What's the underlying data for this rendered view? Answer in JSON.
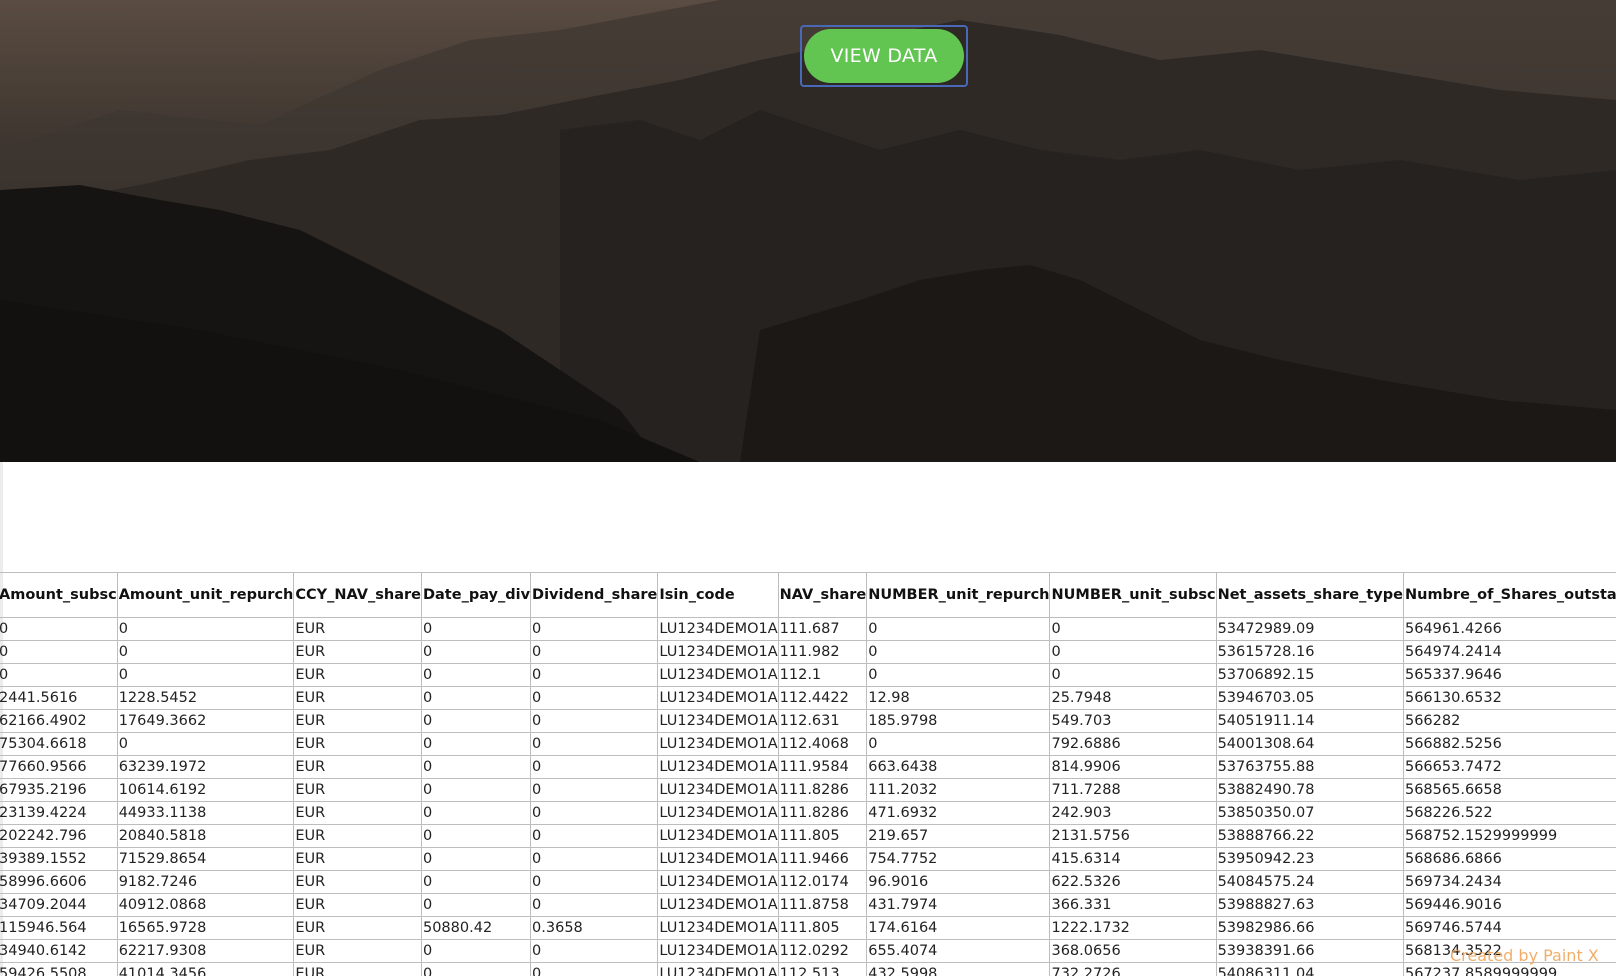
{
  "hero": {
    "button_label": "VIEW DATA"
  },
  "table": {
    "headers": [
      "Amount_subsc",
      "Amount_unit_repurch",
      "CCY_NAV_share",
      "Date_pay_div",
      "Dividend_share",
      "Isin_code",
      "NAV_share",
      "NUMBER_unit_repurch",
      "NUMBER_unit_subsc",
      "Net_assets_share_type",
      "Numbre_of_Shares_outstanding"
    ],
    "rows": [
      [
        "0",
        "0",
        "EUR",
        "0",
        "0",
        "LU1234DEMO1A",
        "111.687",
        "0",
        "0",
        "53472989.09",
        "564961.4266"
      ],
      [
        "0",
        "0",
        "EUR",
        "0",
        "0",
        "LU1234DEMO1A",
        "111.982",
        "0",
        "0",
        "53615728.16",
        "564974.2414"
      ],
      [
        "0",
        "0",
        "EUR",
        "0",
        "0",
        "LU1234DEMO1A",
        "112.1",
        "0",
        "0",
        "53706892.15",
        "565337.9646"
      ],
      [
        "2441.5616",
        "1228.5452",
        "EUR",
        "0",
        "0",
        "LU1234DEMO1A",
        "112.4422",
        "12.98",
        "25.7948",
        "53946703.05",
        "566130.6532"
      ],
      [
        "62166.4902",
        "17649.3662",
        "EUR",
        "0",
        "0",
        "LU1234DEMO1A",
        "112.631",
        "185.9798",
        "549.703",
        "54051911.14",
        "566282"
      ],
      [
        "75304.6618",
        "0",
        "EUR",
        "0",
        "0",
        "LU1234DEMO1A",
        "112.4068",
        "0",
        "792.6886",
        "54001308.64",
        "566882.5256"
      ],
      [
        "77660.9566",
        "63239.1972",
        "EUR",
        "0",
        "0",
        "LU1234DEMO1A",
        "111.9584",
        "663.6438",
        "814.9906",
        "53763755.88",
        "566653.7472"
      ],
      [
        "67935.2196",
        "10614.6192",
        "EUR",
        "0",
        "0",
        "LU1234DEMO1A",
        "111.8286",
        "111.2032",
        "711.7288",
        "53882490.78",
        "568565.6658"
      ],
      [
        "23139.4224",
        "44933.1138",
        "EUR",
        "0",
        "0",
        "LU1234DEMO1A",
        "111.8286",
        "471.6932",
        "242.903",
        "53850350.07",
        "568226.522"
      ],
      [
        "202242.796",
        "20840.5818",
        "EUR",
        "0",
        "0",
        "LU1234DEMO1A",
        "111.805",
        "219.657",
        "2131.5756",
        "53888766.22",
        "568752.1529999999"
      ],
      [
        "39389.1552",
        "71529.8654",
        "EUR",
        "0",
        "0",
        "LU1234DEMO1A",
        "111.9466",
        "754.7752",
        "415.6314",
        "53950942.23",
        "568686.6866"
      ],
      [
        "58996.6606",
        "9182.7246",
        "EUR",
        "0",
        "0",
        "LU1234DEMO1A",
        "112.0174",
        "96.9016",
        "622.5326",
        "54084575.24",
        "569734.2434"
      ],
      [
        "34709.2044",
        "40912.0868",
        "EUR",
        "0",
        "0",
        "LU1234DEMO1A",
        "111.8758",
        "431.7974",
        "366.331",
        "53988827.63",
        "569446.9016"
      ],
      [
        "115946.564",
        "16565.9728",
        "EUR",
        "50880.42",
        "0.3658",
        "LU1234DEMO1A",
        "111.805",
        "174.6164",
        "1222.1732",
        "53982986.66",
        "569746.5744"
      ],
      [
        "34940.6142",
        "62217.9308",
        "EUR",
        "0",
        "0",
        "LU1234DEMO1A",
        "112.0292",
        "655.4074",
        "368.0656",
        "53938391.66",
        "568134.3522"
      ],
      [
        "59426.5508",
        "41014.3456",
        "EUR",
        "0",
        "0",
        "LU1234DEMO1A",
        "112.513",
        "432.5998",
        "732.2726",
        "54086311.04",
        "567237.8589999999"
      ]
    ]
  },
  "watermark": "Created by Paint X"
}
